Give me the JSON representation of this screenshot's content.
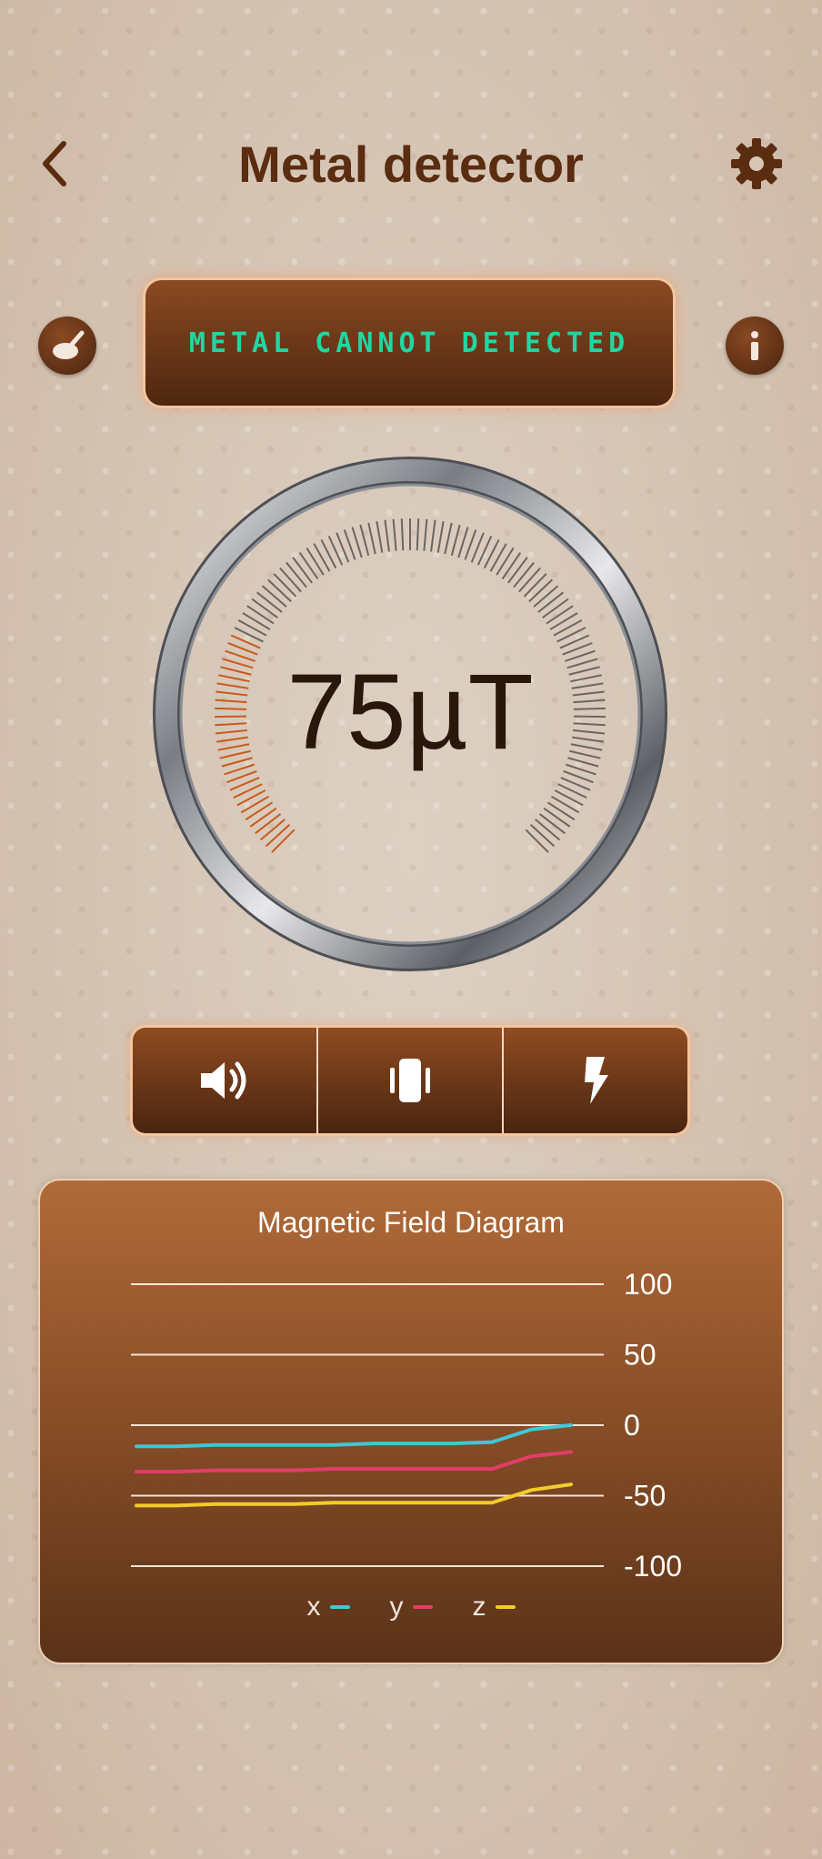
{
  "header": {
    "title": "Metal detector",
    "back_icon": "chevron-left-icon",
    "settings_icon": "gear-icon"
  },
  "status": {
    "text": "METAL CANNOT DETECTED",
    "color": "#22d6a2"
  },
  "side_buttons": {
    "left_icon": "brush-icon",
    "right_icon": "info-icon"
  },
  "gauge": {
    "value_text": "75µT",
    "level": 0.25,
    "accent_color": "#c85a1e"
  },
  "controls": [
    {
      "name": "sound",
      "icon": "speaker-icon"
    },
    {
      "name": "vibrate",
      "icon": "vibrate-icon"
    },
    {
      "name": "flash",
      "icon": "flash-icon"
    }
  ],
  "diagram": {
    "title": "Magnetic Field Diagram",
    "chart_data": {
      "type": "line",
      "title": "Magnetic Field Diagram",
      "ylim": [
        -100,
        100
      ],
      "y_ticks": [
        "100",
        "50",
        "0",
        "-50",
        "-100"
      ],
      "y_tick_values": [
        100,
        50,
        0,
        -50,
        -100
      ],
      "x": [
        0,
        1,
        2,
        3,
        4,
        5,
        6,
        7,
        8,
        9,
        10,
        11
      ],
      "series": [
        {
          "name": "x",
          "color": "#3fc8d6",
          "values": [
            -15,
            -15,
            -14,
            -14,
            -14,
            -14,
            -13,
            -13,
            -13,
            -12,
            -3,
            0
          ]
        },
        {
          "name": "y",
          "color": "#e23d6a",
          "values": [
            -33,
            -33,
            -32,
            -32,
            -32,
            -31,
            -31,
            -31,
            -31,
            -31,
            -22,
            -19
          ]
        },
        {
          "name": "z",
          "color": "#f2cc2a",
          "values": [
            -57,
            -57,
            -56,
            -56,
            -56,
            -55,
            -55,
            -55,
            -55,
            -55,
            -46,
            -42
          ]
        }
      ],
      "grid": true,
      "legend": "bottom"
    }
  },
  "legend": [
    {
      "label": "x",
      "color": "#3fc8d6"
    },
    {
      "label": "y",
      "color": "#e23d6a"
    },
    {
      "label": "z",
      "color": "#f2cc2a"
    }
  ]
}
